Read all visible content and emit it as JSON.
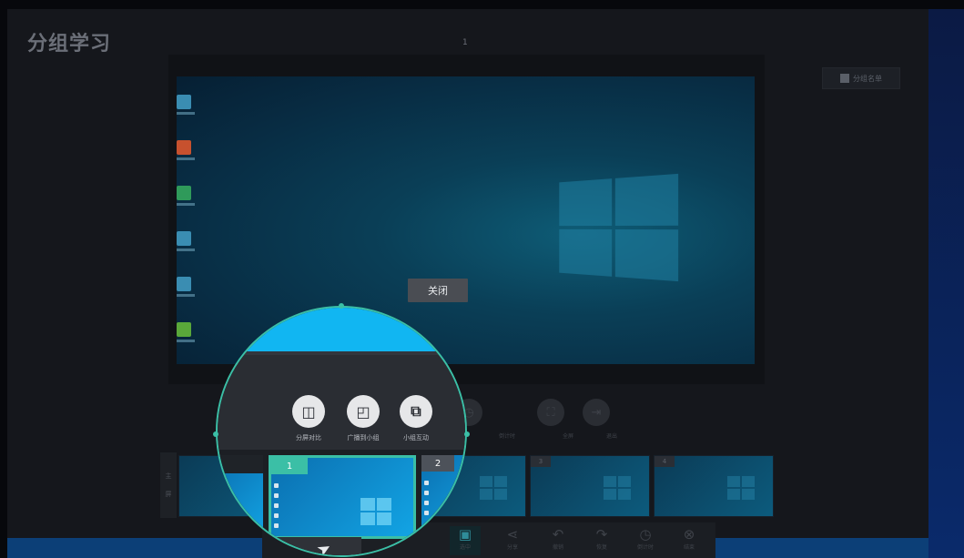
{
  "app": {
    "title": "分组学习",
    "page_number": "1"
  },
  "roster_button": {
    "label": "分组名单"
  },
  "close_button": {
    "label": "关闭"
  },
  "side_tab": {
    "labels": [
      "主",
      "屏"
    ]
  },
  "dim_toolbar": [
    {
      "icon": "clock-icon",
      "label": "倒计时"
    },
    {
      "icon": "fullscreen-icon",
      "label": "全屏"
    },
    {
      "icon": "exit-icon",
      "label": "退出"
    }
  ],
  "thumbnails": [
    {
      "num": ""
    },
    {
      "num": "1"
    },
    {
      "num": "2"
    },
    {
      "num": "3"
    },
    {
      "num": "4"
    }
  ],
  "bottom_bar": [
    {
      "icon": "screen-icon",
      "label": "选中",
      "active": true
    },
    {
      "icon": "share-icon",
      "label": "分享"
    },
    {
      "icon": "undo-icon",
      "label": "撤销"
    },
    {
      "icon": "redo-icon",
      "label": "恢复"
    },
    {
      "icon": "clock-icon",
      "label": "倒计时"
    },
    {
      "icon": "close-circle-icon",
      "label": "结束"
    }
  ],
  "magnifier": {
    "tools": [
      {
        "icon": "split-compare-icon",
        "label": "分屏对比"
      },
      {
        "icon": "broadcast-group-icon",
        "label": "广播到小组"
      },
      {
        "icon": "group-interact-icon",
        "label": "小组互动"
      }
    ],
    "thumbs": [
      {
        "num": "1"
      },
      {
        "num": "2"
      }
    ]
  },
  "colors": {
    "accent": "#3bbfa6",
    "cyan": "#11b6f2",
    "background": "#15171c"
  }
}
